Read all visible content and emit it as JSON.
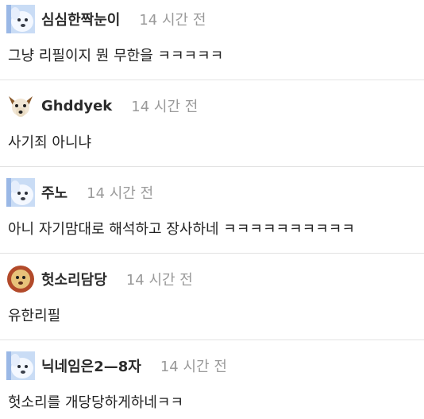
{
  "comments": [
    {
      "nickname": "심심한짝눈이",
      "time": "14 시간 전",
      "text": "그냥 리필이지 뭔 무한을 ㅋㅋㅋㅋㅋ",
      "avatar": "white-dog-avatar-icon"
    },
    {
      "nickname": "Ghddyek",
      "time": "14 시간 전",
      "text": "사기죄 아니냐",
      "avatar": "fox-avatar-icon"
    },
    {
      "nickname": "주노",
      "time": "14 시간 전",
      "text": "아니 자기맘대로 해석하고 장사하네 ㅋㅋㅋㅋㅋㅋㅋㅋㅋㅋ",
      "avatar": "white-dog-avatar-icon"
    },
    {
      "nickname": "헛소리담당",
      "time": "14 시간 전",
      "text": "유한리필",
      "avatar": "lion-avatar-icon"
    },
    {
      "nickname": "닉네임은2—8자",
      "time": "14 시간 전",
      "text": "헛소리를 개당당하게하네ㅋㅋ",
      "avatar": "white-dog-avatar-icon"
    }
  ]
}
